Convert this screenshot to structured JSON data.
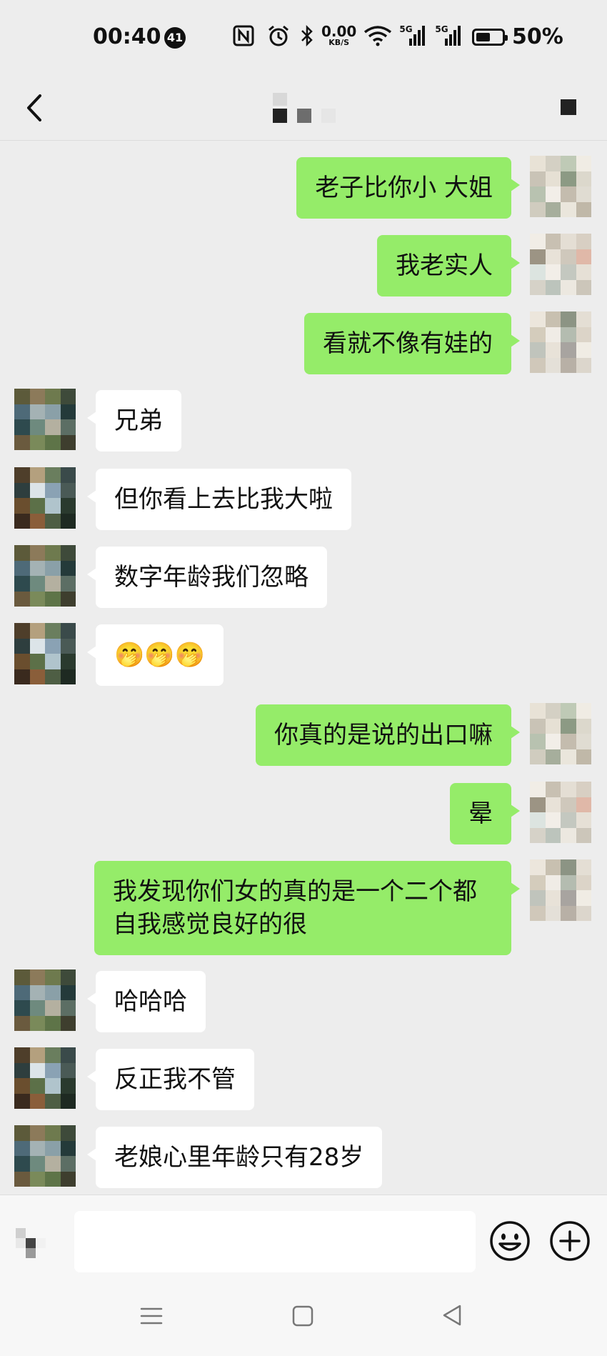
{
  "status_bar": {
    "time": "00:40",
    "notification_count": "41",
    "net_speed_value": "0.00",
    "net_speed_unit": "KB/S",
    "signal_1": "5G",
    "signal_2": "5G",
    "battery_percent": "50%",
    "battery_level": 0.5,
    "icons": [
      "nfc-icon",
      "alarm-icon",
      "bluetooth-icon",
      "wifi-icon",
      "signal-icon",
      "signal-icon",
      "battery-icon"
    ]
  },
  "header": {
    "back_icon": "chevron-left-icon",
    "more_icon": "more-icon"
  },
  "colors": {
    "background": "#ededed",
    "sent_bubble": "#95ec69",
    "received_bubble": "#ffffff"
  },
  "messages": [
    {
      "side": "me",
      "text": "老子比你小  大姐"
    },
    {
      "side": "me",
      "text": "我老实人"
    },
    {
      "side": "me",
      "text": "看就不像有娃的"
    },
    {
      "side": "them",
      "text": "兄弟"
    },
    {
      "side": "them",
      "text": "但你看上去比我大啦"
    },
    {
      "side": "them",
      "text": "数字年龄我们忽略"
    },
    {
      "side": "them",
      "text": "🤭🤭🤭"
    },
    {
      "side": "me",
      "text": "你真的是说的出口嘛"
    },
    {
      "side": "me",
      "text": "晕"
    },
    {
      "side": "me",
      "text": "我发现你们女的真的是一个二个都自我感觉良好的很"
    },
    {
      "side": "them",
      "text": "哈哈哈"
    },
    {
      "side": "them",
      "text": "反正我不管"
    },
    {
      "side": "them",
      "text": "老娘心里年龄只有28岁"
    }
  ],
  "input": {
    "voice_icon": "voice-icon",
    "placeholder": "",
    "emoji_icon": "emoji-icon",
    "plus_icon": "plus-circle-icon"
  },
  "navbar": {
    "icons": [
      "menu-icon",
      "home-square-icon",
      "back-triangle-icon"
    ]
  }
}
